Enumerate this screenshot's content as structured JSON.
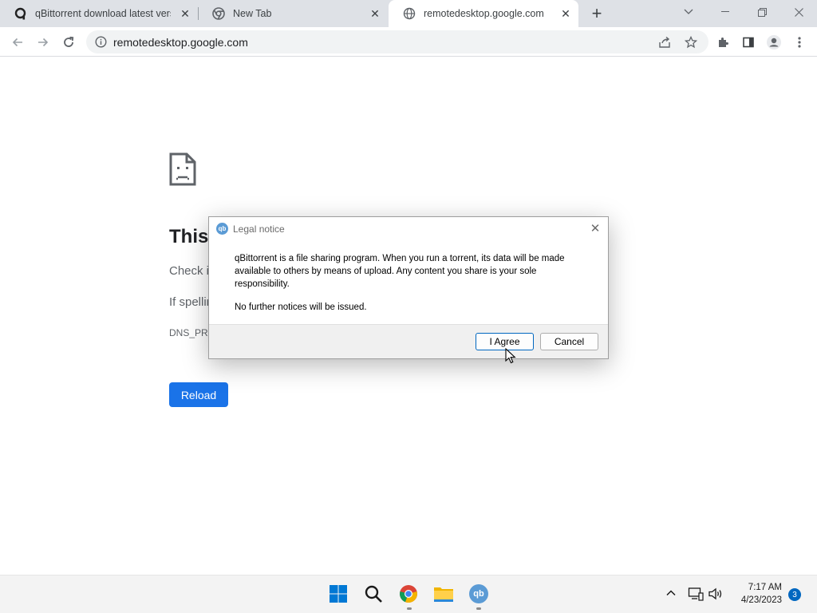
{
  "browser": {
    "tabs": [
      {
        "title": "qBittorrent download latest versi",
        "icon": "qbittorrent-favicon-icon"
      },
      {
        "title": "New Tab",
        "icon": "chrome-icon"
      },
      {
        "title": "remotedesktop.google.com",
        "icon": "globe-icon",
        "active": true
      }
    ],
    "address_url": "remotedesktop.google.com"
  },
  "page": {
    "heading": "This",
    "check_text": "Check i",
    "spelling_text": "If spellir",
    "error_code": "DNS_PRO",
    "reload_label": "Reload"
  },
  "dialog": {
    "title": "Legal notice",
    "message": "qBittorrent is a file sharing program. When you run a torrent, its data will be made available to others by means of upload. Any content you share is your sole responsibility.",
    "message2": "No further notices will be issued.",
    "agree_label": "I Agree",
    "cancel_label": "Cancel",
    "app_icon_text": "qb"
  },
  "taskbar": {
    "qbittorrent_icon_text": "qb",
    "time": "7:17 AM",
    "date": "4/23/2023",
    "notification_count": "3"
  },
  "colors": {
    "accent": "#1a73e8",
    "taskbar_accent": "#0067c0"
  }
}
